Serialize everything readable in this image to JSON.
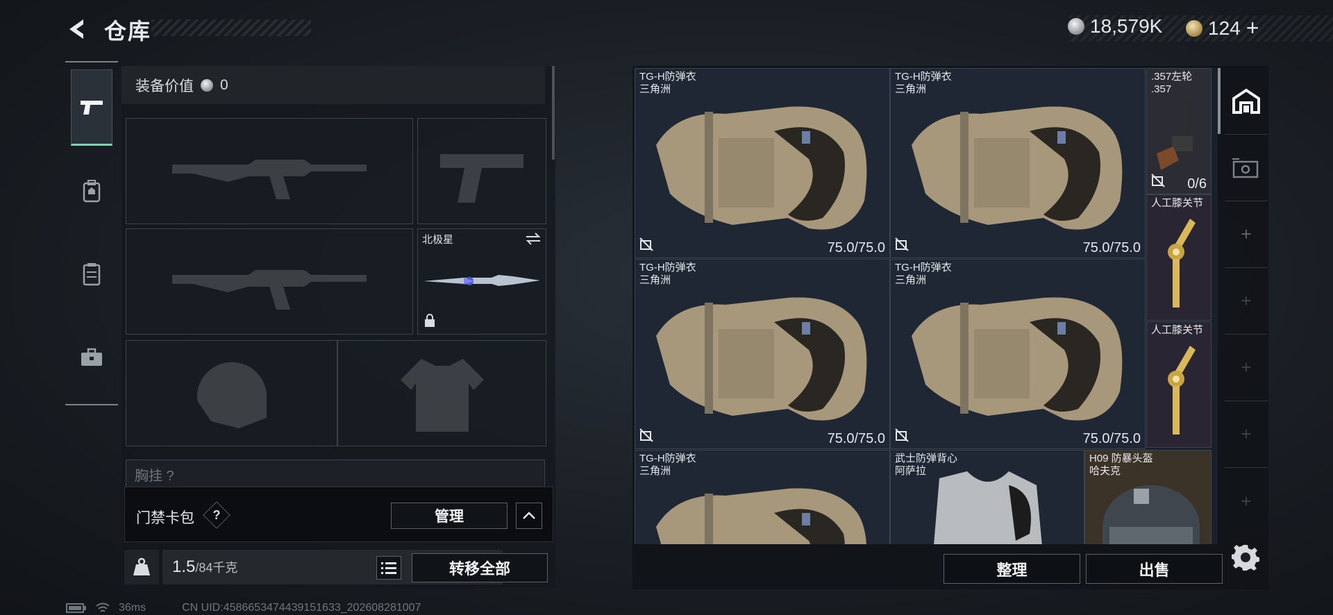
{
  "header": {
    "title": "仓库",
    "currency": [
      {
        "icon": "silver-coin-icon",
        "value": "18,579K"
      },
      {
        "icon": "gold-coin-icon",
        "value": "124"
      }
    ],
    "add_label": "+"
  },
  "tabs": [
    {
      "icon": "pistol-icon",
      "active": true
    },
    {
      "icon": "backpack-icon",
      "active": false
    },
    {
      "icon": "vest-icon",
      "active": false
    },
    {
      "icon": "toolbox-icon",
      "active": false
    }
  ],
  "equipment": {
    "value_label": "装备价值",
    "value": "0",
    "melee_name": "北极星",
    "chest_label": "胸挂 ?"
  },
  "card_bag": {
    "label": "门禁卡包",
    "help": "?",
    "manage": "管理"
  },
  "capacity": {
    "current": "1.5",
    "max": "/84千克",
    "transfer_all": "转移全部"
  },
  "warehouse": {
    "items": [
      {
        "name": "TG-H防弹衣\n三角洲",
        "durability": "75.0/75.0"
      },
      {
        "name": "TG-H防弹衣\n三角洲",
        "durability": "75.0/75.0"
      },
      {
        "name": ".357左轮\n.357",
        "ammo": "0/6"
      },
      {
        "name": "人工膝关节"
      },
      {
        "name": "TG-H防弹衣\n三角洲",
        "durability": "75.0/75.0"
      },
      {
        "name": "TG-H防弹衣\n三角洲",
        "durability": "75.0/75.0"
      },
      {
        "name": "人工膝关节"
      },
      {
        "name": "TG-H防弹衣\n三角洲"
      },
      {
        "name": "武士防弹背心\n阿萨拉"
      },
      {
        "name": "H09 防暴头盔\n哈夫克"
      }
    ],
    "sort": "整理",
    "sell": "出售"
  },
  "status": {
    "ping": "36ms",
    "uid": "CN UID:4586653474439151633_202608281007"
  },
  "colors": {
    "accent": "#7fd1b4",
    "panel": "#1e2733"
  }
}
